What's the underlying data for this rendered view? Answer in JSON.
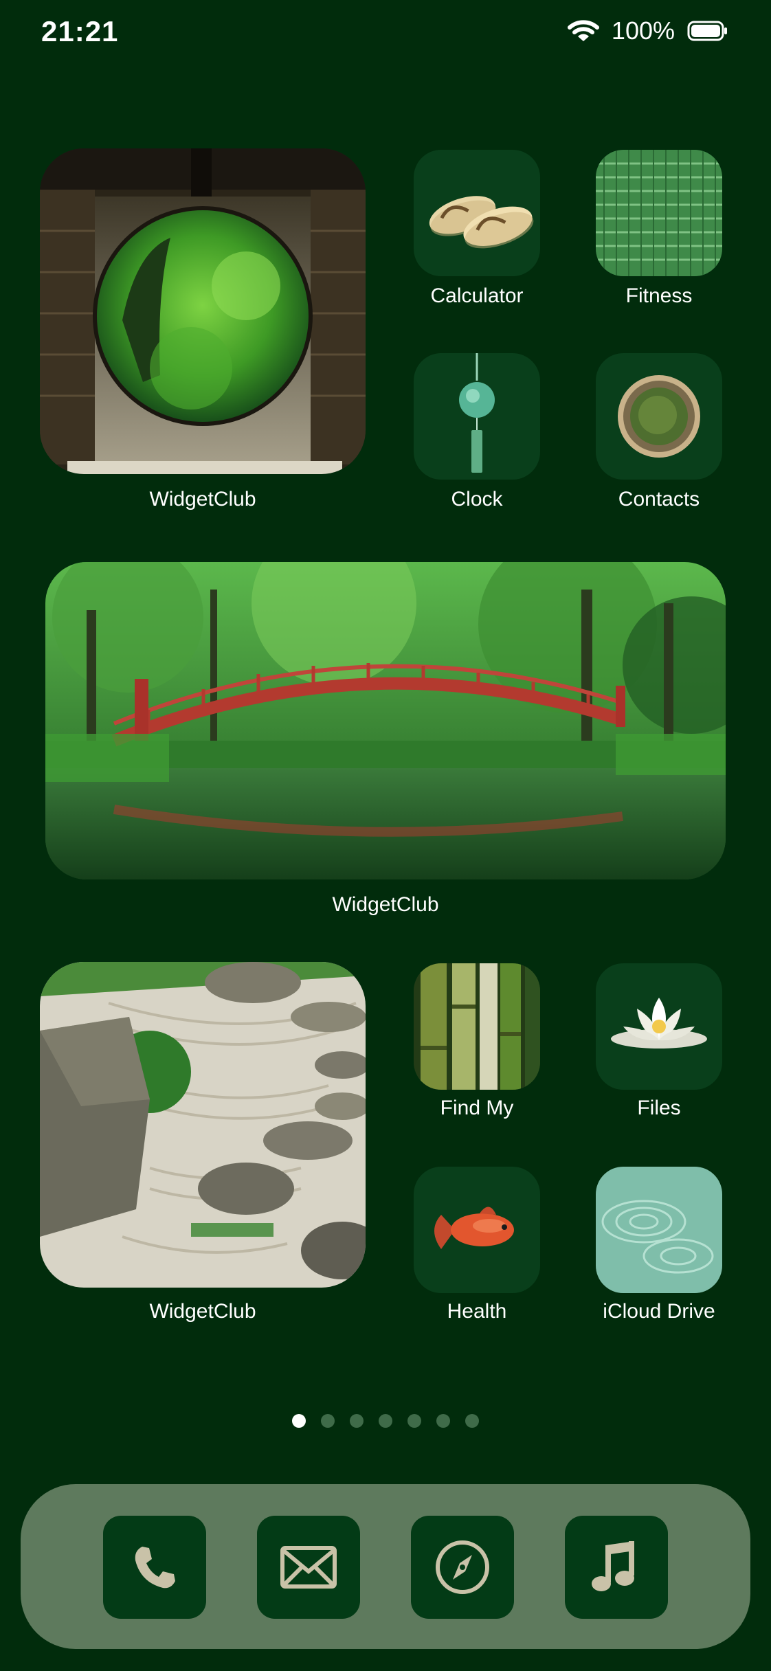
{
  "status_bar": {
    "time": "21:21",
    "battery_percent": "100%",
    "wifi_icon": "wifi-icon",
    "battery_icon": "battery-full-icon"
  },
  "widgets": {
    "top_left": {
      "label": "WidgetClub",
      "image": "round-window-garden"
    },
    "middle_wide": {
      "label": "WidgetClub",
      "image": "red-bridge-pond"
    },
    "bottom_left": {
      "label": "WidgetClub",
      "image": "zen-rock-garden"
    }
  },
  "apps": {
    "calculator": {
      "label": "Calculator",
      "icon": "sandals-icon"
    },
    "fitness": {
      "label": "Fitness",
      "icon": "tatami-icon"
    },
    "clock": {
      "label": "Clock",
      "icon": "wind-chime-icon"
    },
    "contacts": {
      "label": "Contacts",
      "icon": "matcha-bowl-icon"
    },
    "find_my": {
      "label": "Find My",
      "icon": "bamboo-icon"
    },
    "files": {
      "label": "Files",
      "icon": "lotus-icon"
    },
    "health": {
      "label": "Health",
      "icon": "goldfish-icon"
    },
    "icloud_drive": {
      "label": "iCloud Drive",
      "icon": "water-ripple-icon"
    }
  },
  "page_indicator": {
    "total_pages": 7,
    "active_page": 1
  },
  "dock": {
    "items": [
      {
        "name": "phone",
        "icon": "phone-icon"
      },
      {
        "name": "mail",
        "icon": "mail-icon"
      },
      {
        "name": "safari",
        "icon": "compass-icon"
      },
      {
        "name": "music",
        "icon": "music-note-icon"
      }
    ]
  },
  "colors": {
    "background": "#012c0c",
    "tile": "#093f1b",
    "dock": "#5e7a5d",
    "dock_button": "#033b16",
    "dock_glyph": "#c9c2a8"
  }
}
